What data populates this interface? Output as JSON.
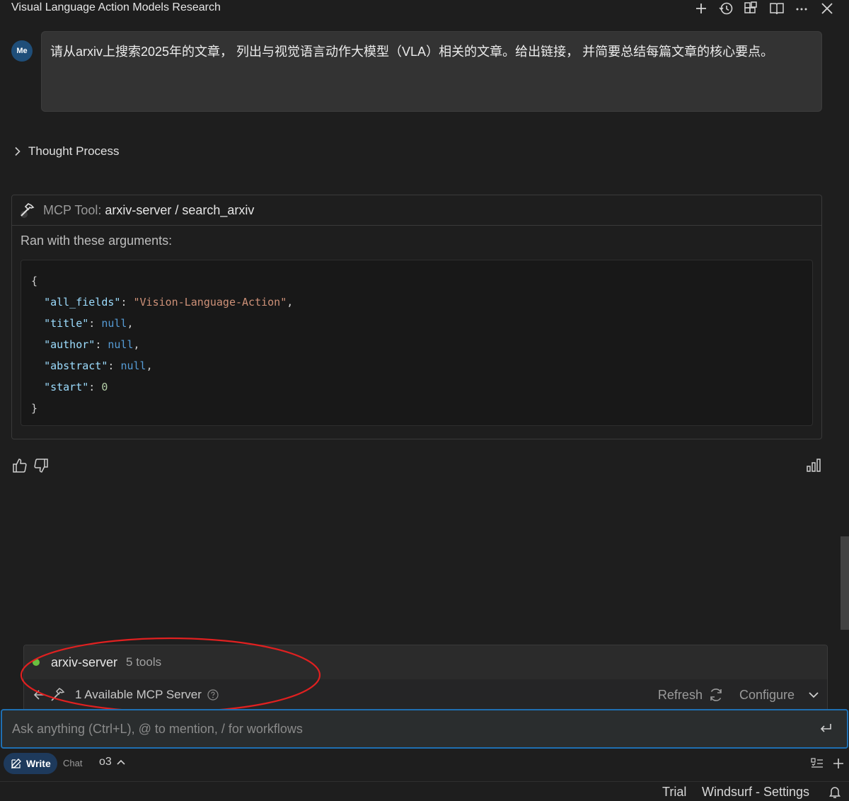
{
  "window": {
    "title": "Visual Language Action Models Research",
    "actions": [
      "plus-icon",
      "history-icon",
      "extensions-icon",
      "book-icon",
      "more-icon",
      "close-icon"
    ]
  },
  "message": {
    "avatar": "Me",
    "text": "请从arxiv上搜索2025年的文章， 列出与视觉语言动作大模型（VLA）相关的文章。给出链接， 并简要总结每篇文章的核心要点。"
  },
  "thought": {
    "label": "Thought Process"
  },
  "tool": {
    "prefix": "MCP Tool: ",
    "name": "arxiv-server / search_arxiv",
    "args_label": "Ran with these arguments:",
    "args": {
      "open": "{",
      "close": "}",
      "k1": "\"all_fields\"",
      "v1": "\"Vision-Language-Action\"",
      "k2": "\"title\"",
      "v2": "null",
      "k3": "\"author\"",
      "v3": "null",
      "k4": "\"abstract\"",
      "v4": "null",
      "k5": "\"start\"",
      "v5": "0"
    }
  },
  "mcp": {
    "server_name": "arxiv-server",
    "server_tools": "5 tools",
    "count_label": "1 Available MCP Server",
    "refresh_label": "Refresh",
    "configure_label": "Configure"
  },
  "input": {
    "placeholder": "Ask anything (Ctrl+L), @ to mention, / for workflows"
  },
  "mode": {
    "write_label": "Write",
    "chat_label": "Chat",
    "model_label": "o3"
  },
  "status": {
    "trial": "Trial",
    "settings": "Windsurf - Settings"
  },
  "colors": {
    "accent": "#1f6fb2",
    "annotation": "#e02020",
    "server_status": "#6abf40"
  }
}
